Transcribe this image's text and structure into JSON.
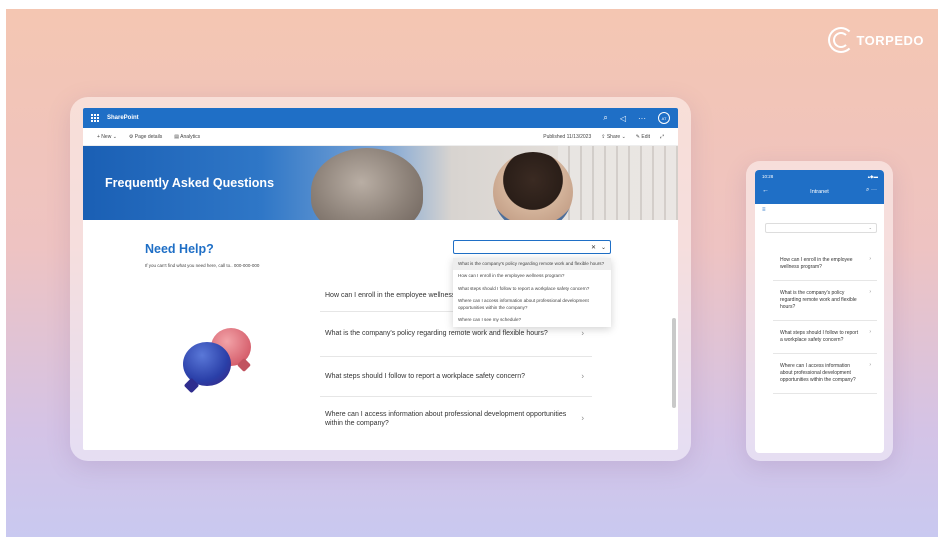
{
  "brand": {
    "name": "TORPEDO"
  },
  "sharepoint": {
    "app_name": "SharePoint",
    "avatar": "AT",
    "command_bar": {
      "new": "+ New ⌄",
      "page_details": "Page details",
      "analytics": "Analytics",
      "published": "Published 11/13/2023",
      "share": "Share ⌄",
      "edit": "Edit"
    },
    "hero_title": "Frequently Asked Questions",
    "help_title": "Need Help?",
    "help_subtitle": "If you can't find what you need here, call to.. 000-000-000",
    "search": {
      "value": "",
      "placeholder": ""
    },
    "dropdown": [
      "What is the company's policy regarding remote work and flexible hours?",
      "How can I enroll in the employee wellness program?",
      "What steps should I follow to report a workplace safety concern?",
      "Where can I access information about professional development opportunities within the company?",
      "Where can I see my schedule?"
    ],
    "faq": [
      "How can I enroll in the employee wellness program?",
      "What is the company's policy regarding remote work and flexible hours?",
      "What steps should I follow to report a workplace safety concern?",
      "Where can I access information about professional development opportunities within the company?"
    ]
  },
  "phone": {
    "time": "10:28",
    "title": "Intranet",
    "faq": [
      "How can I enroll in the employee wellness program?",
      "What is the company's policy regarding remote work and flexible hours?",
      "What steps should I follow to report a workplace safety concern?",
      "Where can I access information about professional development opportunities within the company?"
    ]
  }
}
